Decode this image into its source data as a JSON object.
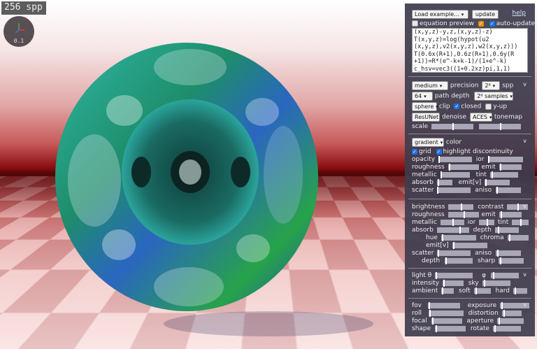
{
  "overlay": {
    "spp_counter": "256 spp",
    "gizmo_value": "0.1"
  },
  "header": {
    "load_example": "Load example...",
    "update_button": "update",
    "help_link": "help",
    "equation_preview": "equation preview",
    "auto_update": "auto-update"
  },
  "code_lines": [
    "(x,y,z)-y,z,(x,y,z)-z)",
    "T(x,y,z)=log(hypot(u2",
    "(x,y,z),v2(x,y,z),w2(x,y,z)))",
    "T(0.6x(R+1),0.6z(R+1),0.6y(R",
    "+1))=R*(e^-k+k-1)/(1+e^-k)",
    "c_hsv=vec3((1+0.2xz)pi,1,1)"
  ],
  "render": {
    "precision_value": "medium",
    "precision_label": "precision",
    "spp_value": "2⁸",
    "spp_label": "spp",
    "depth_value": "64",
    "depth_label": "path depth",
    "samples_value": "2⁸ samples",
    "clip_value": "sphere",
    "clip_label": "clip",
    "closed_label": "closed",
    "yup_label": "y-up",
    "denoise_value": "ResUNet",
    "denoise_label": "denoise",
    "tonemap_value": "ACES",
    "tonemap_label": "tonemap",
    "scale_label": "scale"
  },
  "material": {
    "color_mode": "gradient",
    "color_label": "color",
    "grid_label": "grid",
    "highlight_label": "highlight discontinuity",
    "opacity": "opacity",
    "ior": "ior",
    "roughness": "roughness",
    "emit": "emit",
    "metallic": "metallic",
    "tint": "tint",
    "absorb": "absorb",
    "emit_v": "emit[v]",
    "scatter": "scatter",
    "aniso": "aniso"
  },
  "material2": {
    "brightness": "brightness",
    "contrast": "contrast",
    "roughness": "roughness",
    "emit": "emit",
    "metallic": "metallic",
    "ior": "ior",
    "tint": "tint",
    "absorb": "absorb",
    "depth": "depth",
    "hue": "hue",
    "chroma": "chroma",
    "emit_v": "emit[v]",
    "scatter": "scatter",
    "aniso": "aniso",
    "depth2": "depth",
    "sharp": "sharp"
  },
  "light": {
    "theta": "light θ",
    "phi": "φ",
    "intensity": "intensity",
    "sky": "sky",
    "ambient": "ambient",
    "soft": "soft",
    "hard": "hard"
  },
  "camera": {
    "fov": "fov",
    "exposure": "exposure",
    "roll": "roll",
    "distortion": "distortion",
    "focal": "focal",
    "aperture": "aperture",
    "shape": "shape",
    "rotate": "rotate"
  },
  "collapse_symbol": "v",
  "colors": {
    "panel_bg": "#3e3c4e",
    "checkbox_blue": "#1a73e8",
    "checkbox_orange": "#e8910d",
    "slider_track": "#a9a6b5"
  }
}
